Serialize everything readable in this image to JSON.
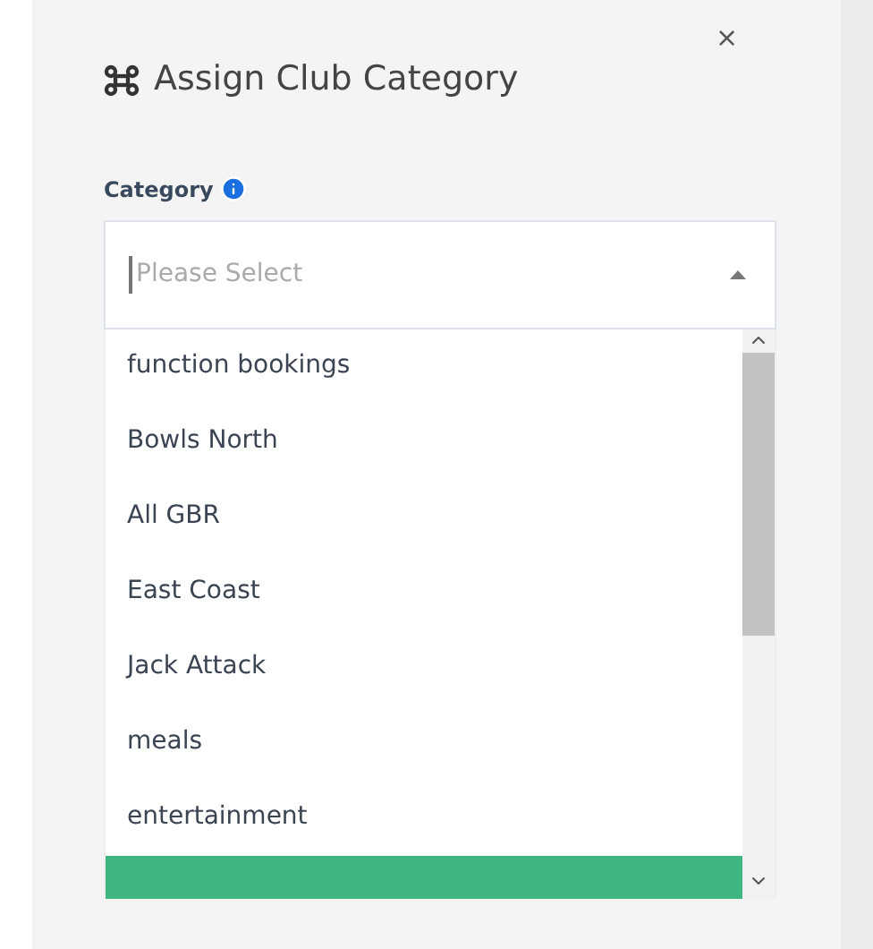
{
  "dialog": {
    "title": "Assign Club Category",
    "close": "×"
  },
  "field": {
    "label": "Category",
    "placeholder": "Please Select",
    "expanded": true
  },
  "options": [
    {
      "label": "function bookings",
      "highlighted": false
    },
    {
      "label": "Bowls North",
      "highlighted": false
    },
    {
      "label": "All GBR",
      "highlighted": false
    },
    {
      "label": "East Coast",
      "highlighted": false
    },
    {
      "label": "Jack Attack",
      "highlighted": false
    },
    {
      "label": "meals",
      "highlighted": false
    },
    {
      "label": "entertainment",
      "highlighted": false
    },
    {
      "highlighted": true
    }
  ]
}
